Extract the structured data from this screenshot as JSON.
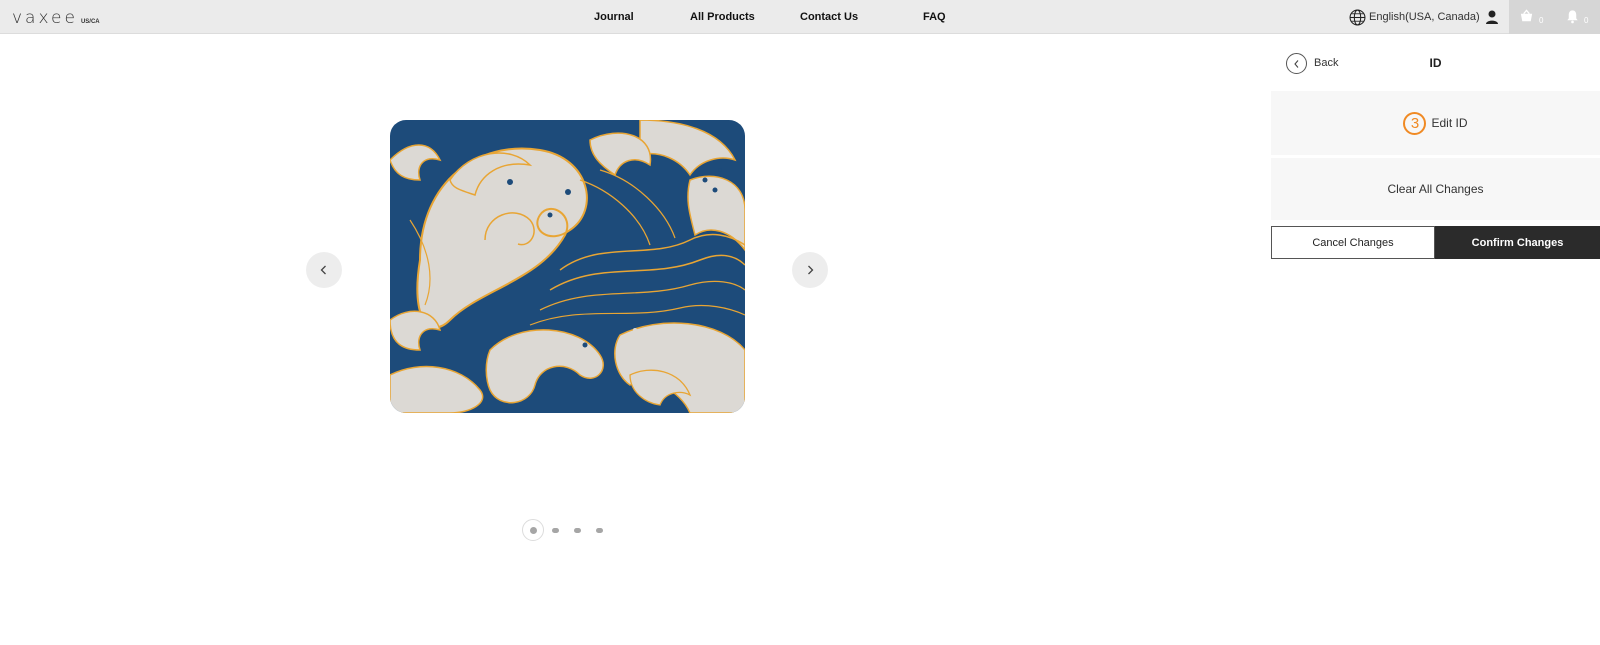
{
  "brand": {
    "logo_text": "vaxee",
    "region": "US/CA"
  },
  "nav": {
    "journal": "Journal",
    "all_products": "All Products",
    "contact_us": "Contact Us",
    "faq": "FAQ"
  },
  "language": {
    "label": "English(USA, Canada)",
    "icon": "globe-icon"
  },
  "icons": {
    "user": "user-icon",
    "cart": "cart-icon",
    "bell": "bell-icon"
  },
  "cart": {
    "count": "0"
  },
  "notifications": {
    "count": "0"
  },
  "gallery": {
    "slides": 4,
    "active_index": 0
  },
  "panel": {
    "back_label": "Back",
    "title": "ID",
    "step_number": "3",
    "edit_label": "Edit ID",
    "clear_label": "Clear All Changes",
    "cancel_label": "Cancel Changes",
    "confirm_label": "Confirm Changes"
  },
  "colors": {
    "accent": "#f08a24",
    "confirm_bg": "#2b2b2b",
    "topbar": "#ebebeb",
    "wave_blue": "#1d4b7a",
    "wave_cream": "#dcd9d4",
    "wave_orange": "#e8a534"
  }
}
